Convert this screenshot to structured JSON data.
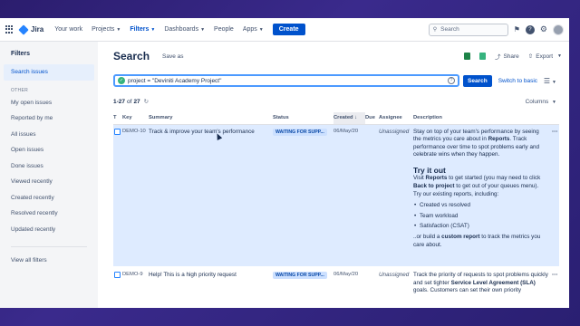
{
  "nav": {
    "logo": "Jira",
    "items": [
      {
        "label": "Your work",
        "caret": false,
        "active": false
      },
      {
        "label": "Projects",
        "caret": true,
        "active": false
      },
      {
        "label": "Filters",
        "caret": true,
        "active": true
      },
      {
        "label": "Dashboards",
        "caret": true,
        "active": false
      },
      {
        "label": "People",
        "caret": false,
        "active": false
      },
      {
        "label": "Apps",
        "caret": true,
        "active": false
      }
    ],
    "create_label": "Create",
    "search_placeholder": "Search"
  },
  "sidebar": {
    "title": "Filters",
    "top_item": "Search issues",
    "section": "OTHER",
    "items": [
      "My open issues",
      "Reported by me",
      "All issues",
      "Open issues",
      "Done issues",
      "Viewed recently",
      "Created recently",
      "Resolved recently",
      "Updated recently"
    ],
    "view_all": "View all filters"
  },
  "header": {
    "title": "Search",
    "save_as": "Save as",
    "share": "Share",
    "export": "Export"
  },
  "query": {
    "text": "project = \"Deviniti Academy Project\"",
    "search_button": "Search",
    "switch_basic": "Switch to basic"
  },
  "results": {
    "count_prefix": "1-27",
    "count_of": "of",
    "count_total": "27",
    "columns_button": "Columns"
  },
  "table": {
    "headers": [
      "T",
      "Key",
      "Summary",
      "Status",
      "Created",
      "Due",
      "Assignee",
      "Description"
    ],
    "sorted_header": "Created",
    "rows": [
      {
        "key": "DEMO-10",
        "summary": "Track & improve your team's performance",
        "status": "WAITING FOR SUPP...",
        "created": "06/May/20",
        "due": "",
        "assignee": "Unassigned",
        "desc_intro_1": "Stay on top of your team's performance by seeing the metrics you care about in ",
        "desc_intro_bold": "Reports",
        "desc_intro_2": ". Track performance over time to spot problems early and celebrate wins when they happen.",
        "desc_heading": "Try it out",
        "desc_p2_1": "Visit ",
        "desc_p2_b1": "Reports",
        "desc_p2_2": " to get started (you may need to click ",
        "desc_p2_b2": "Back to project",
        "desc_p2_3": " to get out of your queues menu).",
        "desc_p3": "Try our existing reports, including:",
        "desc_list": [
          "Created vs resolved",
          "Team workload",
          "Satisfaction (CSAT)"
        ],
        "desc_end_1": "..or build a ",
        "desc_end_b": "custom report",
        "desc_end_2": " to track the metrics you care about."
      },
      {
        "key": "DEMO-9",
        "summary": "Help! This is a high priority request",
        "status": "WAITING FOR SUPP...",
        "created": "06/May/20",
        "due": "",
        "assignee": "Unassigned",
        "desc_1": "Track the priority of requests to spot problems quickly and set tighter ",
        "desc_b": "Service Level Agreement (SLA)",
        "desc_2": " goals. Customers can set their own priority"
      }
    ]
  }
}
